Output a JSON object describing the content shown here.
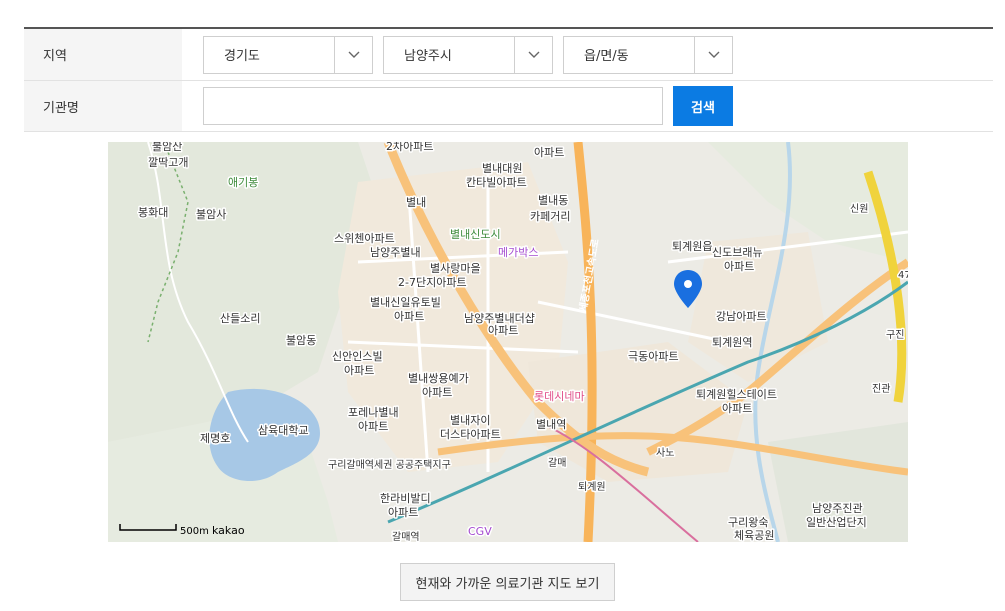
{
  "form": {
    "region_label": "지역",
    "org_label": "기관명",
    "province": "경기도",
    "city": "남양주시",
    "district": "읍/면/동",
    "org_name_value": "",
    "search_label": "검색"
  },
  "map": {
    "scale_text": "500m",
    "provider": "kakao",
    "labels": {
      "l01": "불암산",
      "l02": "깔딱고개",
      "l03": "애기봉",
      "l04": "봉화대",
      "l05": "불암사",
      "l06": "산들소리",
      "l07": "불암동",
      "l08": "삼육대학교",
      "l09": "제명호",
      "l10": "2차아파트",
      "l11": "별내",
      "l12": "별내대원",
      "l13": "칸타빌아파트",
      "l14": "아파트",
      "l15": "별내동",
      "l16": "카페거리",
      "l17": "남양주별내",
      "l18": "스위첸아파트",
      "l19": "별내신도시",
      "l20": "메가박스",
      "l21": "별사랑마을",
      "l22": "2-7단지아파트",
      "l23": "별내신일유토빌",
      "l24": "아파트",
      "l25": "남양주별내더샵",
      "l26": "아파트",
      "l27": "신안인스빌",
      "l28": "아파트",
      "l29": "별내쌍용예가",
      "l30": "아파트",
      "l31": "포레나별내",
      "l32": "아파트",
      "l33": "롯데시네마",
      "l34": "별내자이",
      "l35": "더스타아파트",
      "l36": "별내역",
      "l37": "구리갈매역세권 공공주택지구",
      "l38": "갈매",
      "l39": "퇴계원",
      "l40": "한라비발디",
      "l41": "아파트",
      "l42": "CGV",
      "l43": "갈매역",
      "l44": "세종포천고속도로",
      "l45": "퇴계원읍",
      "l46": "신도브래뉴",
      "l47": "아파트",
      "l48": "강남아파트",
      "l49": "퇴계원역",
      "l50": "극동아파트",
      "l51": "퇴계원힐스테이트",
      "l52": "아파트",
      "l53": "사노",
      "l54": "신원",
      "l55": "구진",
      "l56": "진관",
      "l57": "구리왕숙",
      "l58": "체육공원",
      "l59": "남양주진관",
      "l60": "일반산업단지",
      "l61": "47"
    }
  },
  "bottom": {
    "nearby_label": "현재와 가까운 의료기관 지도 보기"
  },
  "colors": {
    "primary": "#0b7be3",
    "marker": "#1a6fe0"
  }
}
